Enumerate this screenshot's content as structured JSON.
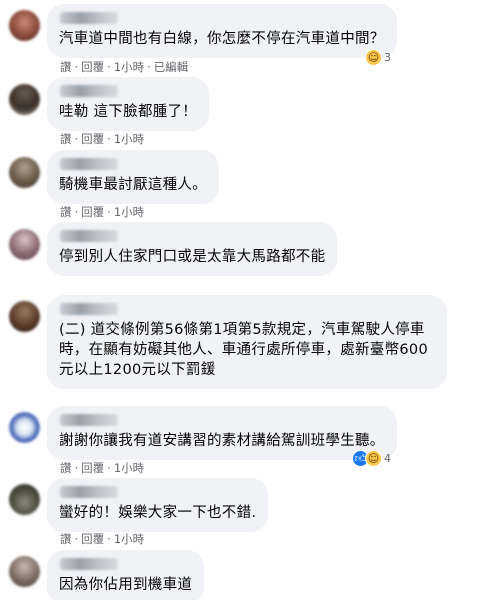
{
  "actions": {
    "like": "讚",
    "reply": "回覆",
    "sep": "·"
  },
  "colors": {
    "bubble": "#f0f2f5",
    "meta": "#65676b",
    "like_blue": "#1877f2",
    "haha_yellow": "#f7c64a"
  },
  "comments": [
    {
      "text": "汽車道中間也有白線，你怎麼不停在汽車道中間？",
      "time": "1小時",
      "edited": "已編輯",
      "reactions": {
        "icons": [
          "haha-icon"
        ],
        "count": "3"
      }
    },
    {
      "text": "哇勒 這下臉都腫了！",
      "time": "1小時"
    },
    {
      "text": "騎機車最討厭這種人。",
      "time": "1小時"
    },
    {
      "text": "停到別人住家門口或是太靠大馬路都不能",
      "time": ""
    },
    {
      "text": "(二) 道交條例第56條第1項第5款規定，汽車駕駛人停車時，在顯有妨礙其他人、車通行處所停車，處新臺幣600元以上1200元以下罰鍰",
      "time": ""
    },
    {
      "text": "謝謝你讓我有道安講習的素材講給駕訓班學生聽。",
      "time": "1小時",
      "reactions": {
        "icons": [
          "like-icon",
          "haha-icon"
        ],
        "count": "4"
      }
    },
    {
      "text": "蠻好的！娛樂大家一下也不錯.",
      "time": "1小時"
    },
    {
      "text": "因為你佔用到機車道",
      "time": ""
    }
  ]
}
